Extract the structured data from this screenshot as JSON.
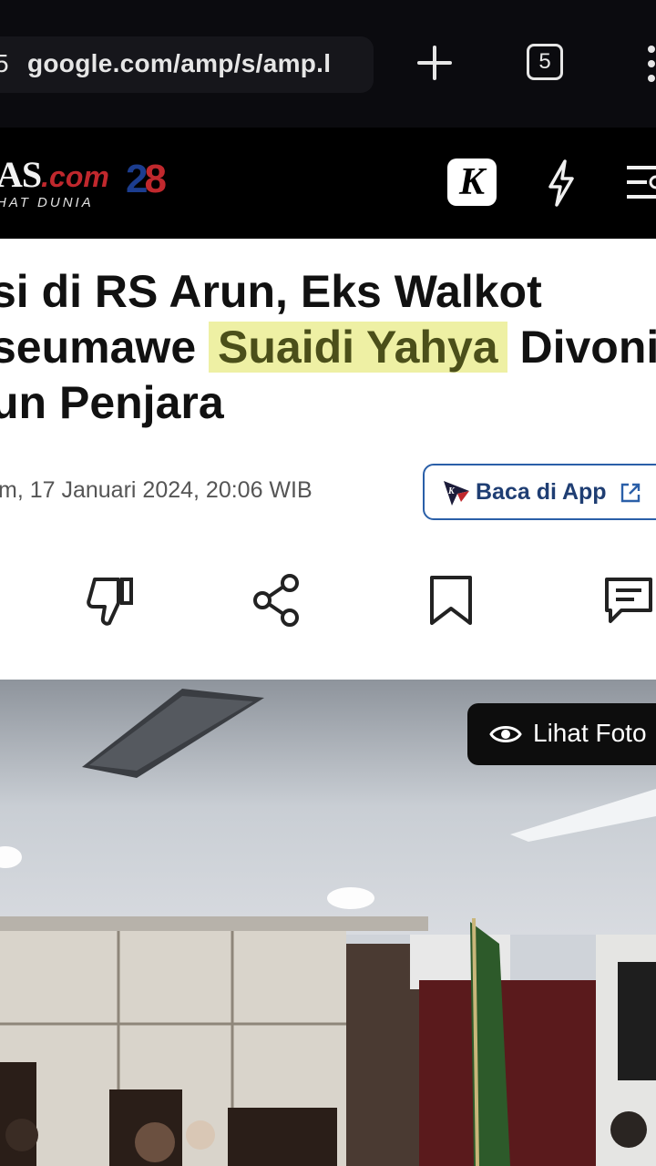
{
  "browser": {
    "url_prefix": "5",
    "url": "google.com/amp/s/amp.l",
    "tab_count": "5"
  },
  "site": {
    "logo_main": "AS",
    "logo_suffix": ".com",
    "logo_tagline": "HAT DUNIA",
    "logo_badge_a": "2",
    "logo_badge_b": "8",
    "app_button_letter": "K"
  },
  "article": {
    "title_line1": "si di RS Arun, Eks Walkot",
    "title_line2_before": "seumawe ",
    "title_line2_highlight": "Suaidi Yahya",
    "title_line2_after": " Divonis",
    "title_line3": "un Penjara",
    "highlight_color": "#eef0a4",
    "date": "m, 17 Januari 2024, 20:06 WIB",
    "app_button_label": "Baca di App"
  },
  "actions": [
    {
      "name": "dislike-icon"
    },
    {
      "name": "share-icon"
    },
    {
      "name": "bookmark-icon"
    },
    {
      "name": "comment-icon"
    }
  ],
  "photo": {
    "view_button_label": "Lihat Foto"
  },
  "colors": {
    "brand_red": "#c0282d",
    "link_blue": "#2a5fa8"
  }
}
